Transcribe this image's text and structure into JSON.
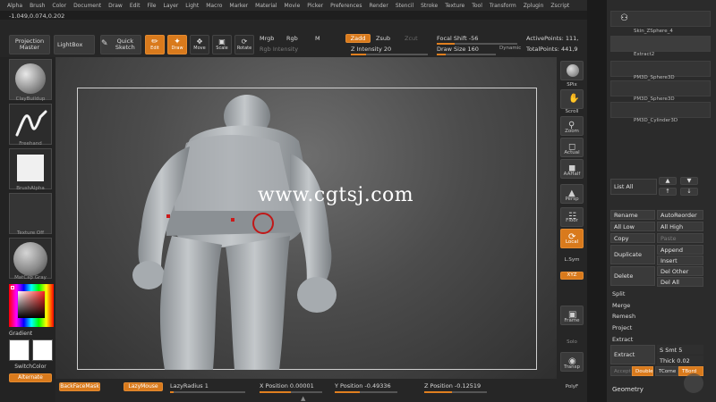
{
  "menu": [
    "Alpha",
    "Brush",
    "Color",
    "Document",
    "Draw",
    "Edit",
    "File",
    "Layer",
    "Light",
    "Macro",
    "Marker",
    "Material",
    "Movie",
    "Picker",
    "Preferences",
    "Render",
    "Stencil",
    "Stroke",
    "Texture",
    "Tool",
    "Transform",
    "Zplugin",
    "Zscript"
  ],
  "coords": "-1.049,0.074,0.202",
  "toolbar": {
    "projection_master": "Projection Master",
    "lightbox": "LightBox",
    "quick_sketch": "Quick Sketch",
    "edit": "Edit",
    "draw": "Draw",
    "move": "Move",
    "scale": "Scale",
    "rotate": "Rotate",
    "mrgb": "Mrgb",
    "rgb": "Rgb",
    "m": "M",
    "rgb_intensity": "Rgb Intensity",
    "zadd": "Zadd",
    "zsub": "Zsub",
    "zcut": "Zcut",
    "z_intensity": "Z Intensity 20",
    "focal_shift": "Focal Shift -56",
    "draw_size": "Draw Size 160",
    "dynamic": "Dynamic",
    "active_points": "ActivePoints: 111,",
    "total_points": "TotalPoints: 441,9"
  },
  "left_tray": {
    "brush": "ClayBuildup",
    "stroke": "Freehand",
    "alpha": "BrushAlpha",
    "texture": "Texture Off",
    "material": "MatCap Gray",
    "gradient": "Gradient",
    "switch_color": "SwitchColor",
    "alternate": "Alternate"
  },
  "watermark": "www.cgtsj.com",
  "bottom": {
    "backface": "BackFaceMask",
    "lazymouse": "LazyMouse",
    "lazyradius": "LazyRadius 1",
    "xpos": "X Position 0.00001",
    "ypos": "Y Position -0.49336",
    "zpos": "Z Position -0.12519"
  },
  "right_shelf": [
    "SPix",
    "Scroll",
    "Zoom",
    "Actual",
    "AAHalf",
    "Persp",
    "Floor",
    "Local",
    "L.Sym",
    "XYZ",
    "Frame",
    "Solo",
    "Transp",
    "PolyF"
  ],
  "palette": {
    "subtools": [
      "Skin_ZSphere_4",
      "Extract2",
      "PM3D_Sphere3D",
      "PM3D_Sphere3D",
      "PM3D_Cylinder3D"
    ],
    "list_all": "List All",
    "rename": "Rename",
    "autoreorder": "AutoReorder",
    "all_low": "All Low",
    "all_high": "All High",
    "copy": "Copy",
    "paste": "Paste",
    "append": "Append",
    "duplicate": "Duplicate",
    "insert": "Insert",
    "delete": "Delete",
    "del_other": "Del Other",
    "del_all": "Del All",
    "split": "Split",
    "merge": "Merge",
    "remesh": "Remesh",
    "project": "Project",
    "extract_header": "Extract",
    "extract_btn": "Extract",
    "s_smt": "S Smt 5",
    "thick": "Thick 0.02",
    "accept": "Accept",
    "double": "Double",
    "tcorner": "TCorne",
    "tborder": "TBord",
    "geometry": "Geometry"
  },
  "colors": {
    "accent": "#d97a1c",
    "panel": "#2b2b2b",
    "frame": "#cfcfcf"
  }
}
